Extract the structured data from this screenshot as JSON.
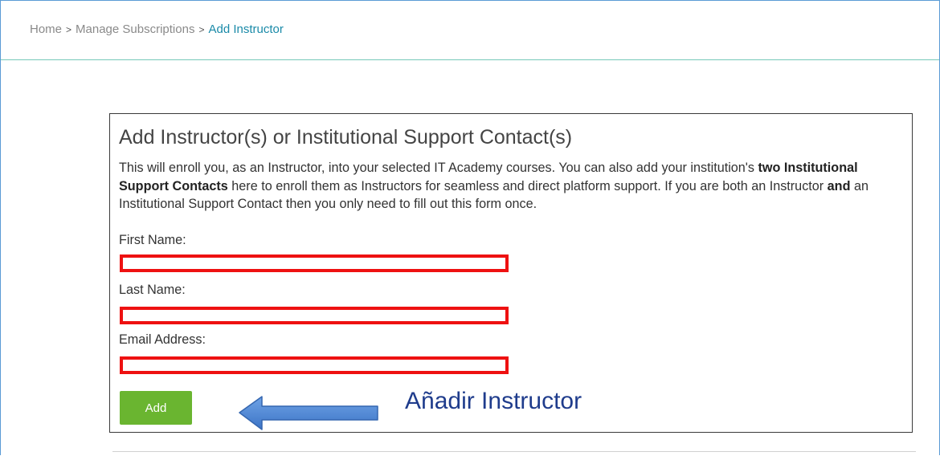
{
  "breadcrumb": {
    "items": [
      "Home",
      "Manage Subscriptions"
    ],
    "separator": ">",
    "current": "Add Instructor"
  },
  "form": {
    "title": "Add Instructor(s) or Institutional Support Contact(s)",
    "intro": {
      "part1": "This will enroll you, as an Instructor, into your selected IT Academy courses. You can also add your institution's ",
      "bold1": "two Institutional Support Contacts",
      "part2": " here to enroll them as Instructors for seamless and direct platform support. If you are both an Instructor ",
      "bold2": "and",
      "part3": " an Institutional Support Contact then you only need to fill out this form once."
    },
    "fields": {
      "first_name": {
        "label": "First Name:",
        "value": ""
      },
      "last_name": {
        "label": "Last Name:",
        "value": ""
      },
      "email": {
        "label": "Email Address:",
        "value": ""
      }
    },
    "add_label": "Add"
  },
  "annotation": {
    "text": "Añadir Instructor",
    "arrow_icon": "left-arrow-icon"
  },
  "colors": {
    "highlight_border": "#ee1111",
    "add_button": "#6ab530",
    "arrow_fill": "#4a86d8",
    "annotation_text": "#1f3c8c",
    "breadcrumb_current": "#1a8aa8"
  }
}
